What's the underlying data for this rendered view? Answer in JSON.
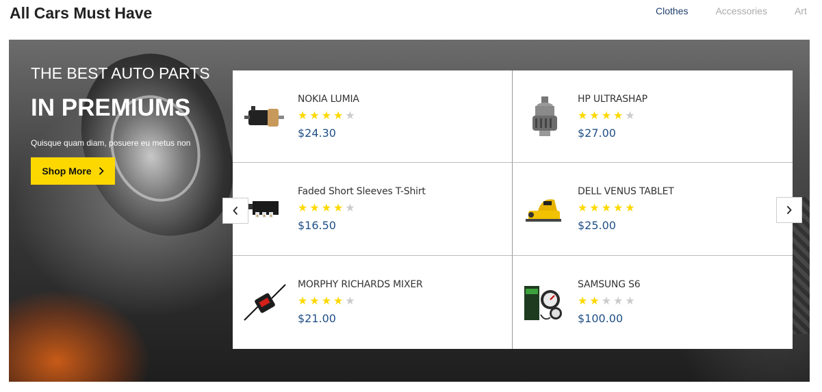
{
  "section": {
    "title": "All Cars Must Have"
  },
  "tabs": [
    {
      "label": "Clothes",
      "active": true
    },
    {
      "label": "Accessories",
      "active": false
    },
    {
      "label": "Art",
      "active": false
    }
  ],
  "banner": {
    "eyebrow": "THE BEST AUTO PARTS",
    "headline": "IN PREMIUMS",
    "tagline": "Quisque quam diam, posuere eu metus non",
    "cta": {
      "label": "Shop More",
      "icon": "chevron-right-icon"
    }
  },
  "carousel": {
    "prev_icon": "chevron-left-icon",
    "next_icon": "chevron-right-icon"
  },
  "products": [
    {
      "name": "NOKIA LUMIA",
      "rating": 4,
      "max_rating": 5,
      "price": "$24.30",
      "image": "motor-image"
    },
    {
      "name": "HP ULTRASHAP",
      "rating": 4,
      "max_rating": 5,
      "price": "$27.00",
      "image": "starter-gear-image"
    },
    {
      "name": "Faded Short Sleeves T-Shirt",
      "rating": 4,
      "max_rating": 5,
      "price": "$16.50",
      "image": "connector-image"
    },
    {
      "name": "DELL VENUS TABLET",
      "rating": 5,
      "max_rating": 5,
      "price": "$25.00",
      "image": "power-planer-image"
    },
    {
      "name": "MORPHY RICHARDS MIXER",
      "rating": 4,
      "max_rating": 5,
      "price": "$21.00",
      "image": "battery-charger-image"
    },
    {
      "name": "SAMSUNG S6",
      "rating": 2,
      "max_rating": 5,
      "price": "$100.00",
      "image": "gauge-kit-image"
    }
  ],
  "colors": {
    "accent": "#fcd800",
    "price": "#1f4e85",
    "tab_active": "#1d3c6a",
    "tab_inactive": "#aaaaaa",
    "star_off": "#cccccc"
  }
}
